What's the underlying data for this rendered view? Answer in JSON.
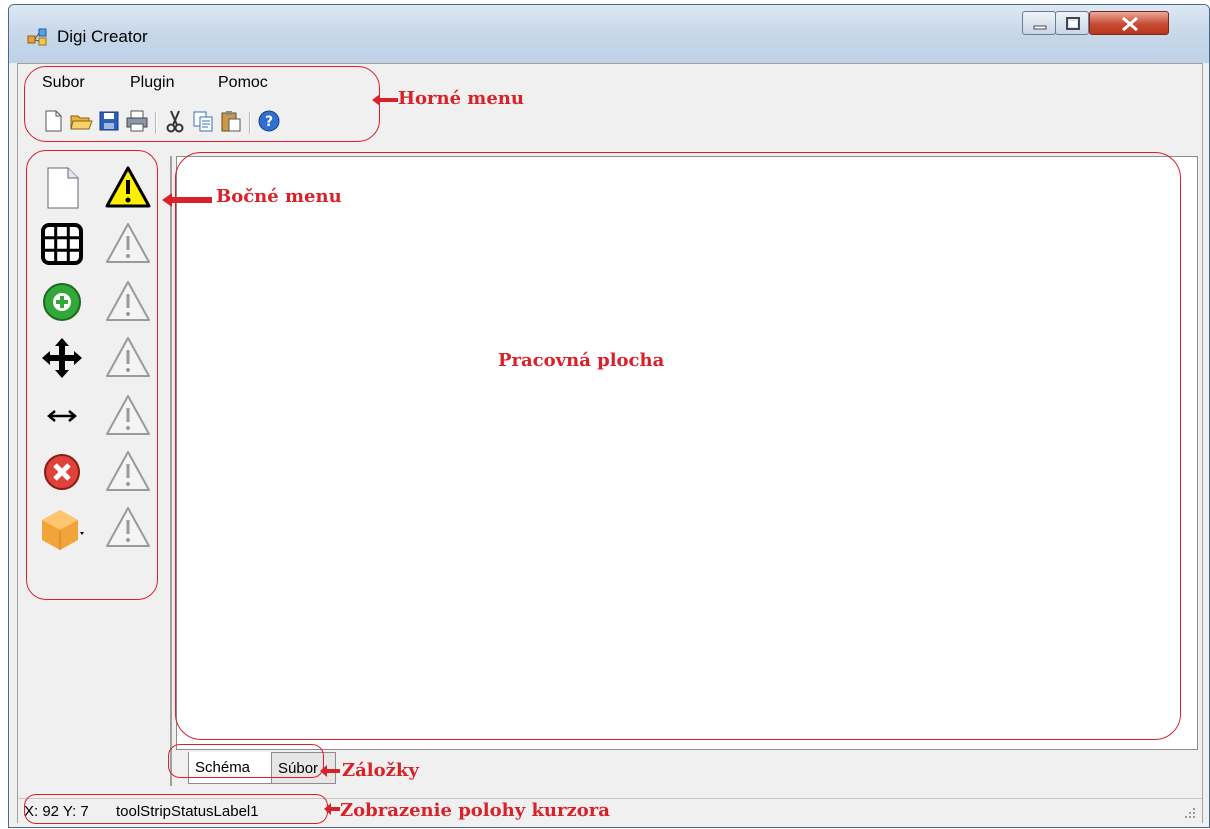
{
  "window": {
    "title": "Digi Creator",
    "controls": [
      "minimize-icon",
      "maximize-icon",
      "close-icon"
    ]
  },
  "menu": {
    "items": [
      "Subor",
      "Plugin",
      "Pomoc"
    ]
  },
  "toolbar": {
    "buttons": [
      "new-file-icon",
      "open-folder-icon",
      "save-icon",
      "print-icon",
      "cut-icon",
      "copy-icon",
      "paste-icon",
      "help-icon"
    ]
  },
  "side_menu": {
    "left_column": [
      "new-page-icon",
      "grid-icon",
      "add-icon",
      "move-icon",
      "resize-horizontal-icon",
      "delete-icon",
      "cube-dropdown-icon"
    ],
    "right_column": [
      "warning-active-icon",
      "warning-disabled-icon",
      "warning-disabled-icon",
      "warning-disabled-icon",
      "warning-disabled-icon",
      "warning-disabled-icon",
      "warning-disabled-icon"
    ]
  },
  "tabs": [
    {
      "label": "Schéma",
      "active": true
    },
    {
      "label": "Súbor",
      "active": false
    }
  ],
  "status": {
    "coords": "X: 92 Y: 7",
    "label": "toolStripStatusLabel1"
  },
  "annotations": {
    "top_menu": "Horné menu",
    "side_menu": "Bočné menu",
    "workspace": "Pracovná plocha",
    "tabs": "Záložky",
    "cursor_position": "Zobrazenie polohy kurzora"
  },
  "colors": {
    "annotation_red": "#d9212a",
    "titlebar": "#c8d8ea",
    "form_background": "#f0f0f0"
  }
}
